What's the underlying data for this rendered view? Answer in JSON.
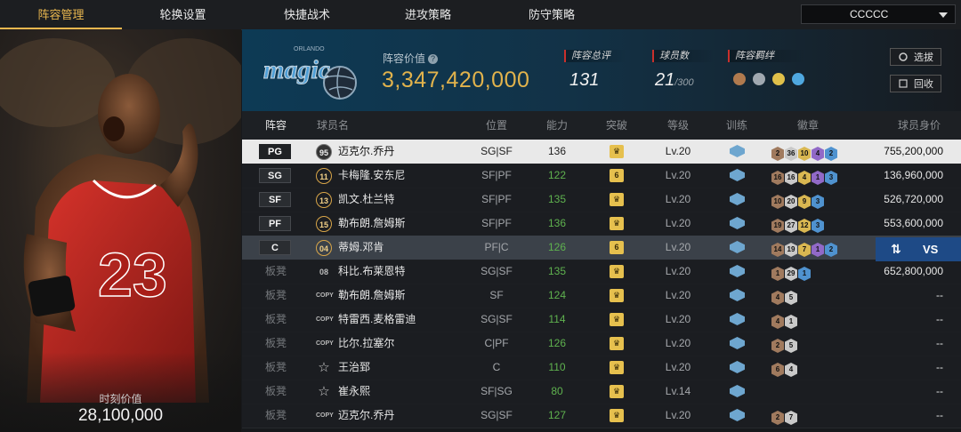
{
  "tabs": [
    {
      "label": "阵容管理",
      "active": true
    },
    {
      "label": "轮换设置",
      "active": false
    },
    {
      "label": "快捷战术",
      "active": false
    },
    {
      "label": "进攻策略",
      "active": false
    },
    {
      "label": "防守策略",
      "active": false
    }
  ],
  "team_select": {
    "value": "CCCCC"
  },
  "featured_player": {
    "moment_label": "时刻价值",
    "moment_value": "28,100,000"
  },
  "team": {
    "logo_text": "magic",
    "logo_sub": "ORLANDO",
    "value_label": "阵容价值",
    "value": "3,347,420,000",
    "overall_label": "阵容总评",
    "overall": "131",
    "roster_label": "球员数",
    "roster_count": "21",
    "roster_max": "/300",
    "bond_label": "阵容羁绊",
    "select_button": "选拔",
    "recycle_button": "回收"
  },
  "table": {
    "headers": [
      "阵容",
      "球员名",
      "位置",
      "能力",
      "突破",
      "等级",
      "训练",
      "徽章",
      "球员身价"
    ],
    "rows": [
      {
        "slot": "PG",
        "starter": true,
        "num": "95",
        "num_style": "dark",
        "name": "迈克尔.乔丹",
        "pos": "SG|SF",
        "ability": "136",
        "green": false,
        "breakthrough": "♛",
        "level": "Lv.20",
        "badges": [
          [
            "b-bronze",
            "2"
          ],
          [
            "b-silver",
            "36"
          ],
          [
            "b-gold",
            "10"
          ],
          [
            "b-purple",
            "4"
          ],
          [
            "b-blue",
            "2"
          ]
        ],
        "salary": "755,200,000"
      },
      {
        "slot": "SG",
        "starter": true,
        "num": "11",
        "num_style": "ring",
        "name": "卡梅隆.安东尼",
        "pos": "SF|PF",
        "ability": "122",
        "green": true,
        "breakthrough": "6",
        "level": "Lv.20",
        "badges": [
          [
            "b-bronze",
            "16"
          ],
          [
            "b-silver",
            "16"
          ],
          [
            "b-gold",
            "4"
          ],
          [
            "b-purple",
            "1"
          ],
          [
            "b-blue",
            "3"
          ]
        ],
        "salary": "136,960,000"
      },
      {
        "slot": "SF",
        "starter": true,
        "num": "13",
        "num_style": "ring",
        "name": "凯文.杜兰特",
        "pos": "SF|PF",
        "ability": "135",
        "green": true,
        "breakthrough": "♛",
        "level": "Lv.20",
        "badges": [
          [
            "b-bronze",
            "10"
          ],
          [
            "b-silver",
            "20"
          ],
          [
            "b-gold",
            "9"
          ],
          [
            "b-blue",
            "3"
          ]
        ],
        "salary": "526,720,000"
      },
      {
        "slot": "PF",
        "starter": true,
        "num": "15",
        "num_style": "ring",
        "name": "勒布朗.詹姆斯",
        "pos": "SF|PF",
        "ability": "136",
        "green": true,
        "breakthrough": "♛",
        "level": "Lv.20",
        "badges": [
          [
            "b-bronze",
            "19"
          ],
          [
            "b-silver",
            "27"
          ],
          [
            "b-gold",
            "12"
          ],
          [
            "b-blue",
            "3"
          ]
        ],
        "salary": "553,600,000"
      },
      {
        "slot": "C",
        "starter": true,
        "num": "04",
        "num_style": "ring",
        "name": "蒂姆.邓肯",
        "pos": "PF|C",
        "ability": "126",
        "green": true,
        "breakthrough": "6",
        "level": "Lv.20",
        "badges": [
          [
            "b-bronze",
            "14"
          ],
          [
            "b-silver",
            "19"
          ],
          [
            "b-gold",
            "7"
          ],
          [
            "b-purple",
            "1"
          ],
          [
            "b-blue",
            "2"
          ]
        ],
        "salary": ""
      },
      {
        "slot": "板凳",
        "starter": false,
        "num": "08",
        "num_style": "plain",
        "name": "科比.布莱恩特",
        "pos": "SG|SF",
        "ability": "135",
        "green": true,
        "breakthrough": "♛",
        "level": "Lv.20",
        "badges": [
          [
            "b-bronze",
            "1"
          ],
          [
            "b-silver",
            "29"
          ],
          [
            "b-blue",
            "1"
          ]
        ],
        "salary": "652,800,000"
      },
      {
        "slot": "板凳",
        "starter": false,
        "num": "COPY",
        "num_style": "copy",
        "name": "勒布朗.詹姆斯",
        "pos": "SF",
        "ability": "124",
        "green": true,
        "breakthrough": "♛",
        "level": "Lv.20",
        "badges": [
          [
            "b-bronze",
            "4"
          ],
          [
            "b-silver",
            "5"
          ]
        ],
        "salary": "--"
      },
      {
        "slot": "板凳",
        "starter": false,
        "num": "COPY",
        "num_style": "copy",
        "name": "特雷西.麦格雷迪",
        "pos": "SG|SF",
        "ability": "114",
        "green": true,
        "breakthrough": "♛",
        "level": "Lv.20",
        "badges": [
          [
            "b-bronze",
            "4"
          ],
          [
            "b-silver",
            "1"
          ]
        ],
        "salary": "--"
      },
      {
        "slot": "板凳",
        "starter": false,
        "num": "COPY",
        "num_style": "copy",
        "name": "比尔.拉塞尔",
        "pos": "C|PF",
        "ability": "126",
        "green": true,
        "breakthrough": "♛",
        "level": "Lv.20",
        "badges": [
          [
            "b-bronze",
            "2"
          ],
          [
            "b-silver",
            "5"
          ]
        ],
        "salary": "--"
      },
      {
        "slot": "板凳",
        "starter": false,
        "num": "☆",
        "num_style": "star",
        "name": "王治郅",
        "pos": "C",
        "ability": "110",
        "green": true,
        "breakthrough": "♛",
        "level": "Lv.20",
        "badges": [
          [
            "b-bronze",
            "6"
          ],
          [
            "b-silver",
            "4"
          ]
        ],
        "salary": "--"
      },
      {
        "slot": "板凳",
        "starter": false,
        "num": "☆",
        "num_style": "star",
        "name": "崔永熙",
        "pos": "SF|SG",
        "ability": "80",
        "green": true,
        "breakthrough": "♛",
        "level": "Lv.14",
        "badges": [],
        "salary": "--"
      },
      {
        "slot": "板凳",
        "starter": false,
        "num": "COPY",
        "num_style": "copy",
        "name": "迈克尔.乔丹",
        "pos": "SG|SF",
        "ability": "127",
        "green": true,
        "breakthrough": "♛",
        "level": "Lv.20",
        "badges": [
          [
            "b-bronze",
            "2"
          ],
          [
            "b-silver",
            "7"
          ]
        ],
        "salary": "--"
      }
    ]
  },
  "compare": {
    "label": "VS"
  }
}
